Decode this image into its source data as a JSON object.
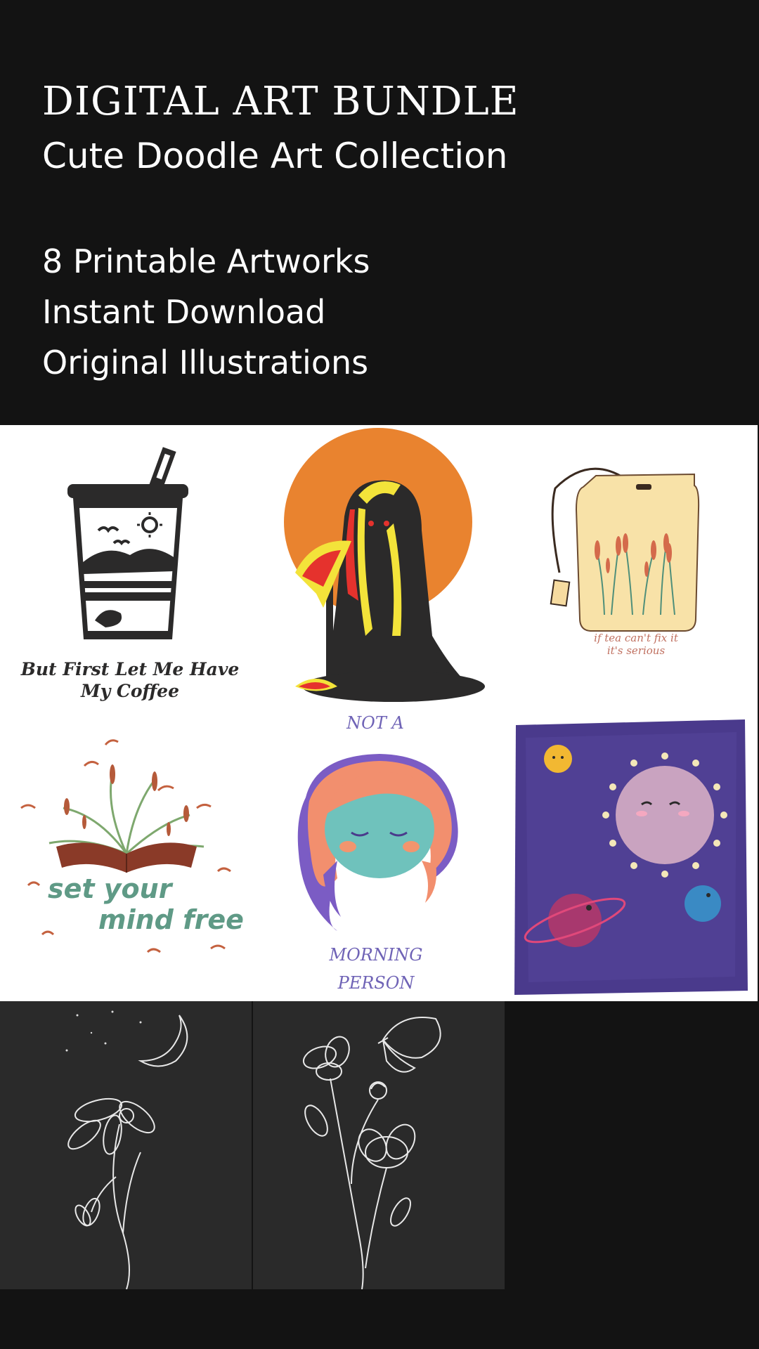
{
  "header": {
    "title": "DIGITAL ART BUNDLE",
    "subtitle": "Cute Doodle Art Collection",
    "features": [
      "8 Printable Artworks",
      "Instant Download",
      "Original Illustrations"
    ]
  },
  "artworks": {
    "coffee": {
      "caption_line1": "But First Let Me Have",
      "caption_line2": "My Coffee"
    },
    "reaper": {
      "caption": "NOT A"
    },
    "tea": {
      "caption_line1": "if tea can't fix it",
      "caption_line2": "it's serious"
    },
    "book": {
      "caption_line1": "set your",
      "caption_line2": "mind free"
    },
    "morning": {
      "caption_line1": "MORNING",
      "caption_line2": "PERSON"
    },
    "space": {},
    "moonflower": {},
    "flowers": {}
  },
  "colors": {
    "background": "#131313",
    "text": "#ffffff",
    "orange": "#e9832f",
    "dark": "#2b2a2a",
    "purple": "#4a3a8c",
    "lavender": "#7b68c9",
    "teal": "#5a9a88"
  }
}
